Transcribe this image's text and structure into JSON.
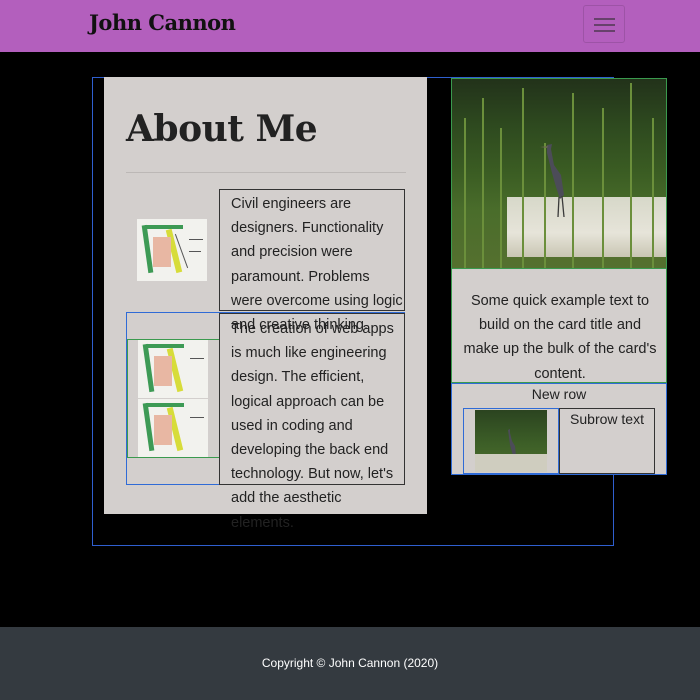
{
  "navbar": {
    "brand": "John Cannon",
    "toggle_icon": "hamburger-menu-icon",
    "color": "#b35fbd"
  },
  "about": {
    "title": "About Me",
    "paragraph_1": "Civil engineers are designers. Functionality and precision were paramount. Problems were overcome using logic and creative thinking.",
    "paragraph_2": "The creation of web apps is much like engineering design. The efficient, logical approach can be used in coding and developing the back end technology. But now, let's add the aesthetic elements."
  },
  "card": {
    "text": "Some quick example text to build on the card title and make up the bulk of the card's content.",
    "new_row_label": "New row",
    "subrow_text": "Subrow text"
  },
  "footer": {
    "copyright": "Copyright © John Cannon (2020)",
    "color": "#343a40"
  }
}
